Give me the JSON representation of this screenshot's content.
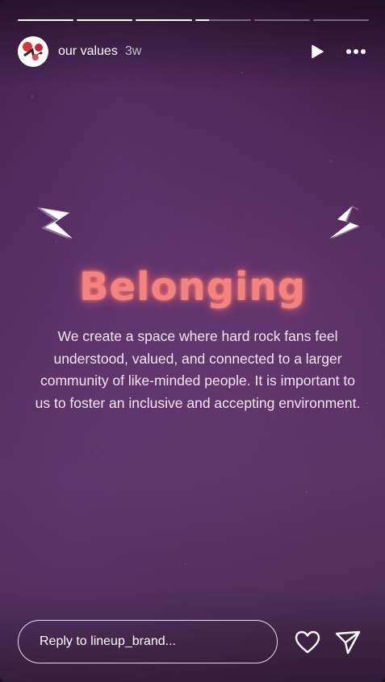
{
  "progress": [
    1,
    1,
    1,
    0.25,
    0,
    0
  ],
  "header": {
    "username": "our values",
    "timestamp": "3w",
    "avatar_icon": "lineup-brand-logo",
    "play_icon": "play-icon",
    "more_icon": "more-options-icon"
  },
  "content": {
    "headline": "Belonging",
    "body": "We create a space where hard rock fans feel understood, valued, and connected to a larger community of like-minded people. It is important to us to foster an inclusive and accepting environment.",
    "headline_color": "#f3837c",
    "decor_icon": "lightning-bolt-icon"
  },
  "footer": {
    "reply_placeholder": "Reply to lineup_brand...",
    "like_icon": "heart-icon",
    "send_icon": "send-icon"
  }
}
